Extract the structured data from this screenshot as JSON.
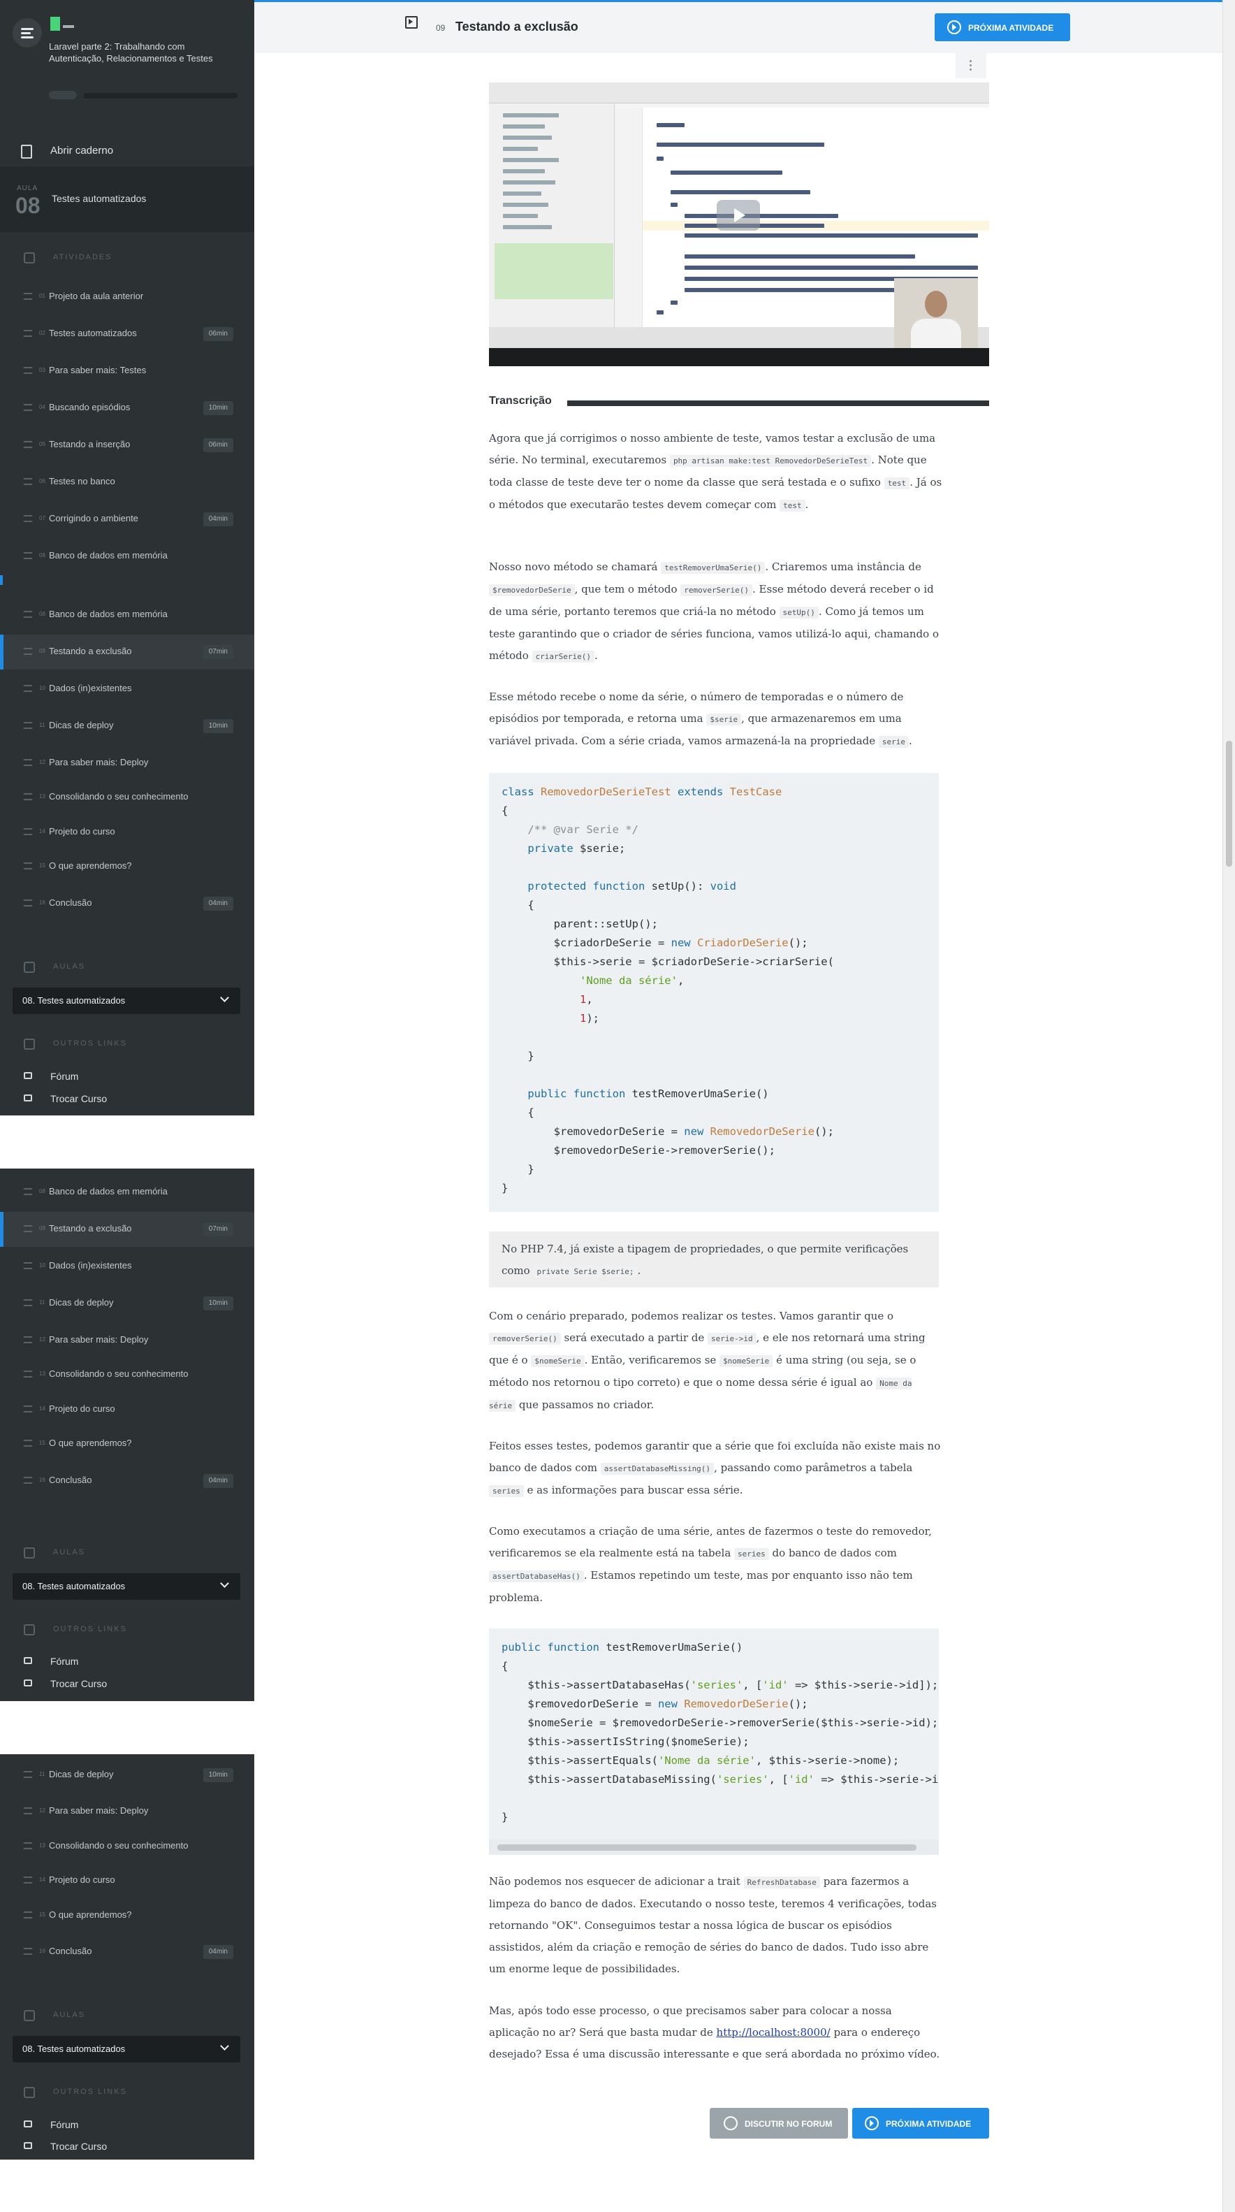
{
  "course": {
    "name": "Laravel parte 2: Trabalhando com Autenticação, Relacionamentos e Testes"
  },
  "sidebar": {
    "notebook": "Abrir caderno",
    "aula_label": "AULA",
    "aula_number": "08",
    "aula_title": "Testes automatizados",
    "activities_title": "ATIVIDADES",
    "aulas_title": "AULAS",
    "aula_select": "08. Testes automatizados",
    "links_title": "OUTROS LINKS",
    "links": [
      "Fórum",
      "Trocar Curso"
    ],
    "activities": [
      {
        "no": "01",
        "label": "Projeto da aula anterior",
        "dur": ""
      },
      {
        "no": "02",
        "label": "Testes automatizados",
        "dur": "06min"
      },
      {
        "no": "03",
        "label": "Para saber mais: Testes",
        "dur": ""
      },
      {
        "no": "04",
        "label": "Buscando episódios",
        "dur": "10min"
      },
      {
        "no": "05",
        "label": "Testando a inserção",
        "dur": "06min"
      },
      {
        "no": "06",
        "label": "Testes no banco",
        "dur": ""
      },
      {
        "no": "07",
        "label": "Corrigindo o ambiente",
        "dur": "04min"
      },
      {
        "no": "08",
        "label": "Banco de dados em memória",
        "dur": ""
      },
      {
        "no": "09",
        "label": "Testando a exclusão",
        "dur": "07min"
      },
      {
        "no": "10",
        "label": "Dados (in)existentes",
        "dur": ""
      },
      {
        "no": "11",
        "label": "Dicas de deploy",
        "dur": "10min"
      },
      {
        "no": "12",
        "label": "Para saber mais: Deploy",
        "dur": ""
      },
      {
        "no": "13",
        "label": "Consolidando o seu conhecimento",
        "dur": ""
      },
      {
        "no": "14",
        "label": "Projeto do curso",
        "dur": ""
      },
      {
        "no": "15",
        "label": "O que aprendemos?",
        "dur": ""
      },
      {
        "no": "16",
        "label": "Conclusão",
        "dur": "04min"
      }
    ]
  },
  "header": {
    "number": "09",
    "title": "Testando a exclusão",
    "next_button": "PRÓXIMA ATIVIDADE"
  },
  "content": {
    "transcription_title": "Transcrição",
    "p1_a": "Agora que já corrigimos o nosso ambiente de teste, vamos testar a exclusão de uma série. No terminal, executaremos ",
    "p1_code1": "php artisan make:test RemovedorDeSerieTest",
    "p1_b": ". Note que toda classe de teste deve ter o nome da classe que será testada e o sufixo ",
    "p1_code2": "test",
    "p1_c": ". Já os o métodos que executarão testes devem começar com ",
    "p1_code3": "test",
    "p1_d": ".",
    "p2_a": "Nosso novo método se chamará ",
    "p2_code1": "testRemoverUmaSerie()",
    "p2_b": ". Criaremos uma instância de ",
    "p2_code2": "$removedorDeSerie",
    "p2_c": ", que tem o método ",
    "p2_code3": "removerSerie()",
    "p2_d": ". Esse método deverá receber o id de uma série, portanto teremos que criá-la no método ",
    "p2_code4": "setUp()",
    "p2_e": ". Como já temos um teste garantindo que o criador de séries funciona, vamos utilizá-lo aqui, chamando o método ",
    "p2_code5": "criarSerie()",
    "p2_f": ".",
    "p3_a": "Esse método recebe o nome da série, o número de temporadas e o número de episódios por temporada, e retorna uma ",
    "p3_code1": "$serie",
    "p3_b": ", que armazenaremos em uma variável privada. Com a série criada, vamos armazená-la na propriedade ",
    "p3_code2": "serie",
    "p3_c": ".",
    "note_a": "No PHP 7.4, já existe a tipagem de propriedades, o que permite verificações como ",
    "note_code": "private Serie $serie;",
    "note_b": ".",
    "p4_a": "Com o cenário preparado, podemos realizar os testes. Vamos garantir que o ",
    "p4_code1": "removerSerie()",
    "p4_b": " será executado a partir de ",
    "p4_code2": "serie->id",
    "p4_c": ", e ele nos retornará uma string que é o ",
    "p4_code3": "$nomeSerie",
    "p4_d": ". Então, verificaremos se ",
    "p4_code4": "$nomeSerie",
    "p4_e": " é uma string (ou seja, se o método nos retornou o tipo correto) e que o nome dessa série é igual ao ",
    "p4_code5": "Nome da série",
    "p4_f": " que passamos no criador.",
    "p5_a": "Feitos esses testes, podemos garantir que a série que foi excluída não existe mais no banco de dados com ",
    "p5_code1": "assertDatabaseMissing()",
    "p5_b": ", passando como parâmetros a tabela ",
    "p5_code2": "series",
    "p5_c": " e as informações para buscar essa série.",
    "p6_a": "Como executamos a criação de uma série, antes de fazermos o teste do removedor, verificaremos se ela realmente está na tabela ",
    "p6_code1": "series",
    "p6_b": " do banco de dados com ",
    "p6_code2": "assertDatabaseHas()",
    "p6_c": ". Estamos repetindo um teste, mas por enquanto isso não tem problema.",
    "p7_a": "Não podemos nos esquecer de adicionar a trait ",
    "p7_code1": "RefreshDatabase",
    "p7_b": " para fazermos a limpeza do banco de dados. Executando o nosso teste, teremos 4 verificações, todas retornando \"OK\". Conseguimos testar a nossa lógica de buscar os episódios assistidos, além da criação e remoção de séries do banco de dados. Tudo isso abre um enorme leque de possibilidades.",
    "p8_a": "Mas, após todo esse processo, o que precisamos saber para colocar a nossa aplicação no ar? Será que basta mudar de ",
    "p8_link": "http://localhost:8000/",
    "p8_b": " para o endereço desejado? Essa é uma discussão interessante e que será abordada no próximo vídeo."
  },
  "footer": {
    "forum_button": "DISCUTIR NO FORUM",
    "next_button": "PRÓXIMA ATIVIDADE"
  },
  "colors": {
    "accent": "#1f8ce6",
    "sidebar": "#2c3134"
  }
}
